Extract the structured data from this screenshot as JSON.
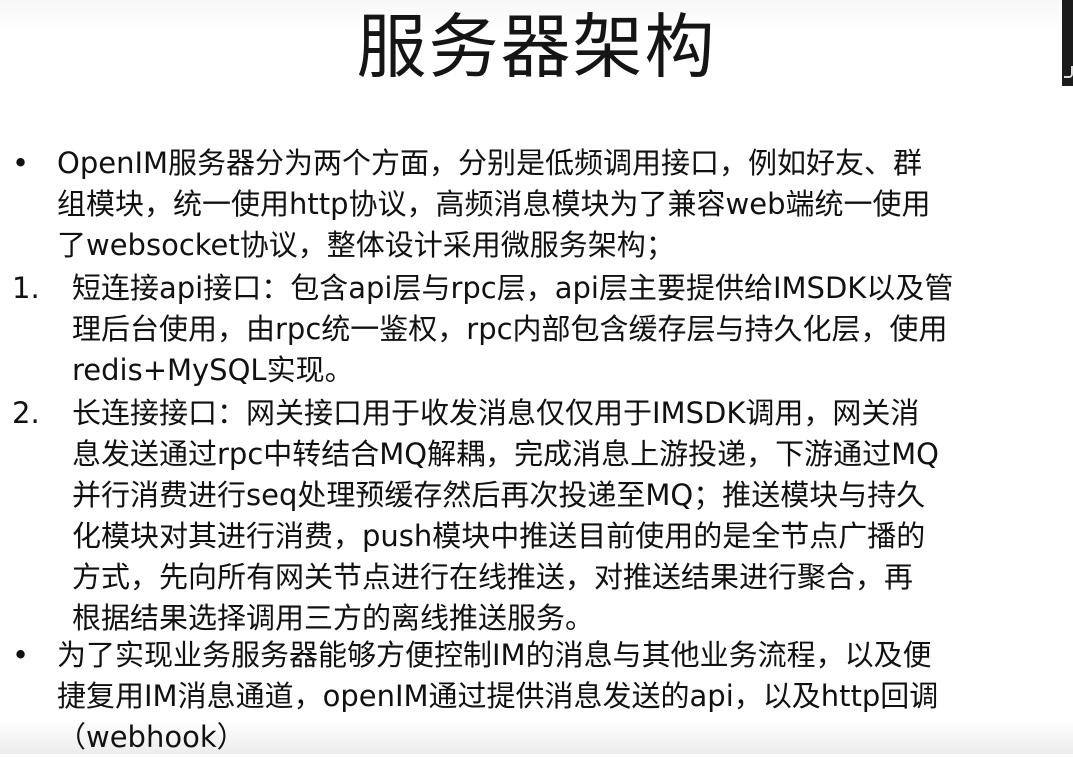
{
  "title": "服务器架构",
  "items": [
    {
      "marker": "•",
      "lines": [
        "OpenIM服务器分为两个方面，分别是低频调用接口，例如好友、群",
        "组模块，统一使用http协议，高频消息模块为了兼容web端统一使用",
        "了websocket协议，整体设计采用微服务架构；"
      ]
    },
    {
      "marker": "1.",
      "lines": [
        "短连接api接口：包含api层与rpc层，api层主要提供给IMSDK以及管",
        "理后台使用，由rpc统一鉴权，rpc内部包含缓存层与持久化层，使用",
        "redis+MySQL实现。"
      ]
    },
    {
      "marker": "2.",
      "lines": [
        "长连接接口：网关接口用于收发消息仅仅用于IMSDK调用，网关消",
        "息发送通过rpc中转结合MQ解耦，完成消息上游投递，下游通过MQ",
        "并行消费进行seq处理预缓存然后再次投递至MQ；推送模块与持久",
        "化模块对其进行消费，push模块中推送目前使用的是全节点广播的",
        "方式，先向所有网关节点进行在线推送，对推送结果进行聚合，再",
        "根据结果选择调用三方的离线推送服务。"
      ]
    },
    {
      "marker": "•",
      "lines": [
        "为了实现业务服务器能够方便控制IM的消息与其他业务流程，以及便",
        "捷复用IM消息通道，openIM通过提供消息发送的api，以及http回调",
        "（webhook）"
      ]
    }
  ]
}
